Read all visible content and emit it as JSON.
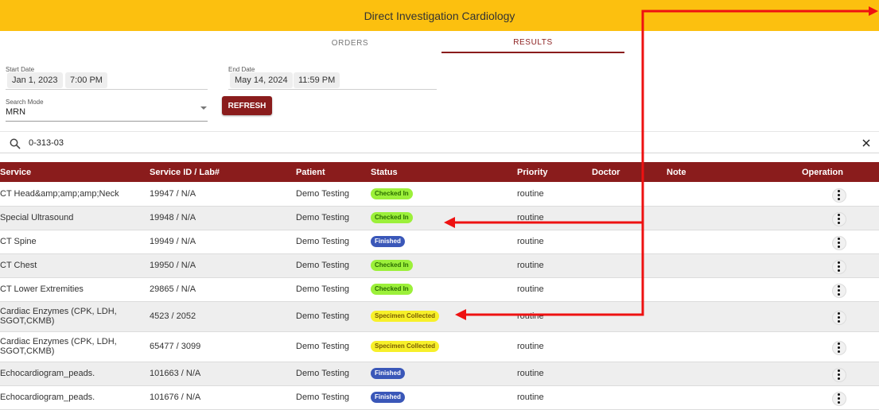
{
  "header": {
    "title": "Direct Investigation Cardiology",
    "bg_color": "#fcc00f"
  },
  "tabs": [
    {
      "label": "ORDERS",
      "active": false
    },
    {
      "label": "RESULTS",
      "active": true
    }
  ],
  "filters": {
    "start_date_label": "Start Date",
    "start_date": "Jan 1, 2023",
    "start_time": "7:00 PM",
    "end_date_label": "End Date",
    "end_date": "May 14, 2024",
    "end_time": "11:59 PM",
    "search_mode_label": "Search Mode",
    "search_mode_value": "MRN",
    "refresh_label": "REFRESH"
  },
  "search": {
    "value": "0-313-03"
  },
  "table": {
    "headers": {
      "service": "Service",
      "service_id": "Service ID / Lab#",
      "patient": "Patient",
      "status": "Status",
      "priority": "Priority",
      "doctor": "Doctor",
      "note": "Note",
      "operation": "Operation"
    },
    "rows": [
      {
        "service": "CT Head&amp;amp;amp;Neck",
        "service_id": "19947 / N/A",
        "patient": "Demo Testing",
        "status": "Checked In",
        "priority": "routine",
        "doctor": "",
        "note": ""
      },
      {
        "service": "Special Ultrasound",
        "service_id": "19948 / N/A",
        "patient": "Demo Testing",
        "status": "Checked In",
        "priority": "routine",
        "doctor": "",
        "note": ""
      },
      {
        "service": "CT Spine",
        "service_id": "19949 / N/A",
        "patient": "Demo Testing",
        "status": "Finished",
        "priority": "routine",
        "doctor": "",
        "note": ""
      },
      {
        "service": "CT Chest",
        "service_id": "19950 / N/A",
        "patient": "Demo Testing",
        "status": "Checked In",
        "priority": "routine",
        "doctor": "",
        "note": ""
      },
      {
        "service": "CT Lower Extremities",
        "service_id": "29865 / N/A",
        "patient": "Demo Testing",
        "status": "Checked In",
        "priority": "routine",
        "doctor": "",
        "note": ""
      },
      {
        "service": "Cardiac Enzymes (CPK, LDH, SGOT,CKMB)",
        "service_id": "4523 / 2052",
        "patient": "Demo Testing",
        "status": "Specimen Collected",
        "priority": "routine",
        "doctor": "",
        "note": ""
      },
      {
        "service": "Cardiac Enzymes (CPK, LDH, SGOT,CKMB)",
        "service_id": "65477 / 3099",
        "patient": "Demo Testing",
        "status": "Specimen Collected",
        "priority": "routine",
        "doctor": "",
        "note": ""
      },
      {
        "service": "Echocardiogram_peads.",
        "service_id": "101663 / N/A",
        "patient": "Demo Testing",
        "status": "Finished",
        "priority": "routine",
        "doctor": "",
        "note": ""
      },
      {
        "service": "Echocardiogram_peads.",
        "service_id": "101676 / N/A",
        "patient": "Demo Testing",
        "status": "Finished",
        "priority": "routine",
        "doctor": "",
        "note": ""
      }
    ]
  },
  "colors": {
    "accent": "#8a1c1c",
    "annotation_arrow": "#ee1111",
    "status_checked_in": "#9cf03a",
    "status_finished": "#3a57b8",
    "status_specimen_collected": "#f7f02a"
  },
  "icons": {
    "search": "search-icon",
    "clear": "close-icon",
    "operation": "more-vert-icon"
  }
}
